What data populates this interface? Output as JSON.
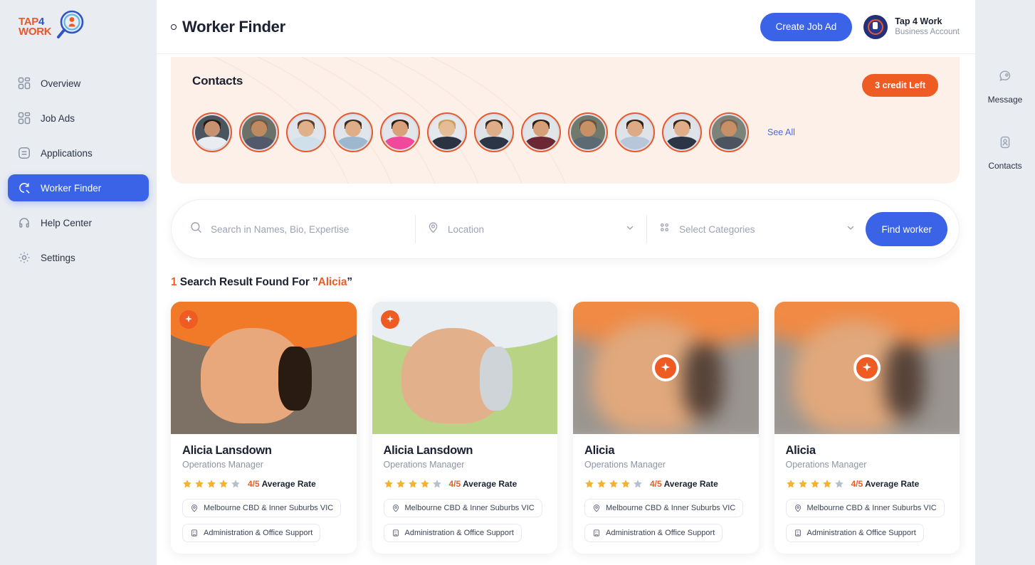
{
  "brand": {
    "logo_line1": "TAP",
    "logo_four": "4",
    "logo_line2": "WORK",
    "accent_orange": "#e8582a",
    "accent_blue": "#2f55c4"
  },
  "sidebar": {
    "items": [
      {
        "label": "Overview",
        "icon": "grid-icon",
        "active": false
      },
      {
        "label": "Job Ads",
        "icon": "grid-icon",
        "active": false
      },
      {
        "label": "Applications",
        "icon": "document-list-icon",
        "active": false
      },
      {
        "label": "Worker Finder",
        "icon": "search-refresh-icon",
        "active": true
      },
      {
        "label": "Help Center",
        "icon": "headset-icon",
        "active": false
      },
      {
        "label": "Settings",
        "icon": "gear-icon",
        "active": false
      }
    ]
  },
  "header": {
    "title": "Worker Finder",
    "create_job_ad_label": "Create Job Ad",
    "account_name": "Tap 4 Work",
    "account_type": "Business Account"
  },
  "contacts": {
    "title": "Contacts",
    "credit_badge": "3 credit Left",
    "see_all_label": "See All",
    "avatar_count": 12,
    "avatars": [
      {
        "name": "contact-avatar-1",
        "bg": "#4a5560",
        "skin": "#c69272",
        "hair": "#241a14",
        "cloth": "#e9edf1"
      },
      {
        "name": "contact-avatar-2",
        "bg": "#6b7168",
        "skin": "#c08a60",
        "hair": "#6d5a46",
        "cloth": "#52596a"
      },
      {
        "name": "contact-avatar-3",
        "bg": "#dfe5ea",
        "skin": "#e0b08a",
        "hair": "#5a3f2b",
        "cloth": "#cfe0ea"
      },
      {
        "name": "contact-avatar-4",
        "bg": "#dfe5ea",
        "skin": "#dfae88",
        "hair": "#3b2a1d",
        "cloth": "#9db7cf"
      },
      {
        "name": "contact-avatar-5",
        "bg": "#e2e6ea",
        "skin": "#d9a07a",
        "hair": "#2a1d15",
        "cloth": "#f0489a"
      },
      {
        "name": "contact-avatar-6",
        "bg": "#e4e8ec",
        "skin": "#e6bc96",
        "hair": "#c8a060",
        "cloth": "#2b3342"
      },
      {
        "name": "contact-avatar-7",
        "bg": "#dfe4e9",
        "skin": "#dfae88",
        "hair": "#3b2a1d",
        "cloth": "#2c3545"
      },
      {
        "name": "contact-avatar-8",
        "bg": "#e0e5ea",
        "skin": "#d5a078",
        "hair": "#2a1d15",
        "cloth": "#6b2733"
      },
      {
        "name": "contact-avatar-9",
        "bg": "#6f7a6c",
        "skin": "#c79067",
        "hair": "#6a5340",
        "cloth": "#5d6a74"
      },
      {
        "name": "contact-avatar-10",
        "bg": "#dde3e9",
        "skin": "#dcaa84",
        "hair": "#2f2118",
        "cloth": "#b8c6da"
      },
      {
        "name": "contact-avatar-11",
        "bg": "#dde3e9",
        "skin": "#dfae88",
        "hair": "#33241a",
        "cloth": "#2c3545"
      },
      {
        "name": "contact-avatar-12",
        "bg": "#7d8379",
        "skin": "#c79067",
        "hair": "#7a6450",
        "cloth": "#4c545f"
      }
    ]
  },
  "search": {
    "name_placeholder": "Search in Names, Bio, Expertise",
    "name_value": "",
    "location_label": "Location",
    "categories_label": "Select Categories",
    "find_worker_label": "Find worker"
  },
  "results": {
    "count": "1",
    "prefix": "Search Result Found For ”",
    "query": "Alicia",
    "suffix": "”",
    "cards": [
      {
        "name": "Alicia Lansdown",
        "role": "Operations Manager",
        "rating": 4,
        "rating_label": "4/5",
        "rating_suffix": "Average Rate",
        "location_tag": "Melbourne CBD & Inner Suburbs VIC",
        "category_tag": "Administration & Office Support",
        "blurred": false,
        "badge_position": "corner",
        "photo": {
          "bg": "#7d7166",
          "accent": "#f07a28",
          "skin": "#e8a87c",
          "hair": "#2a1b12"
        }
      },
      {
        "name": "Alicia Lansdown",
        "role": "Operations Manager",
        "rating": 4,
        "rating_label": "4/5",
        "rating_suffix": "Average Rate",
        "location_tag": "Melbourne CBD & Inner Suburbs VIC",
        "category_tag": "Administration & Office Support",
        "blurred": false,
        "badge_position": "corner",
        "photo": {
          "bg": "#b7d383",
          "accent": "#e9eef2",
          "skin": "#e3b08c",
          "hair": "#cfd4d8"
        }
      },
      {
        "name": "Alicia",
        "role": "Operations Manager",
        "rating": 4,
        "rating_label": "4/5",
        "rating_suffix": "Average Rate",
        "location_tag": "Melbourne CBD & Inner Suburbs VIC",
        "category_tag": "Administration & Office Support",
        "blurred": true,
        "badge_position": "center",
        "photo": {
          "bg": "#9a9590",
          "accent": "#f08a45",
          "skin": "#e0a87c",
          "hair": "#564238"
        }
      },
      {
        "name": "Alicia",
        "role": "Operations Manager",
        "rating": 4,
        "rating_label": "4/5",
        "rating_suffix": "Average Rate",
        "location_tag": "Melbourne CBD & Inner Suburbs VIC",
        "category_tag": "Administration & Office Support",
        "blurred": true,
        "badge_position": "center",
        "photo": {
          "bg": "#9a9590",
          "accent": "#f08a45",
          "skin": "#e0a87c",
          "hair": "#564238"
        }
      }
    ]
  },
  "rail": {
    "items": [
      {
        "label": "Message",
        "icon": "chat-bubble-icon"
      },
      {
        "label": "Contacts",
        "icon": "user-card-icon"
      }
    ]
  },
  "colors": {
    "brand_blue": "#3b63e8",
    "brand_orange": "#ee5b23",
    "sidebar_bg": "#e9edf2",
    "contacts_bg": "#fdf0e9",
    "star_filled": "#f5b133",
    "star_empty": "#b9c0cc"
  }
}
